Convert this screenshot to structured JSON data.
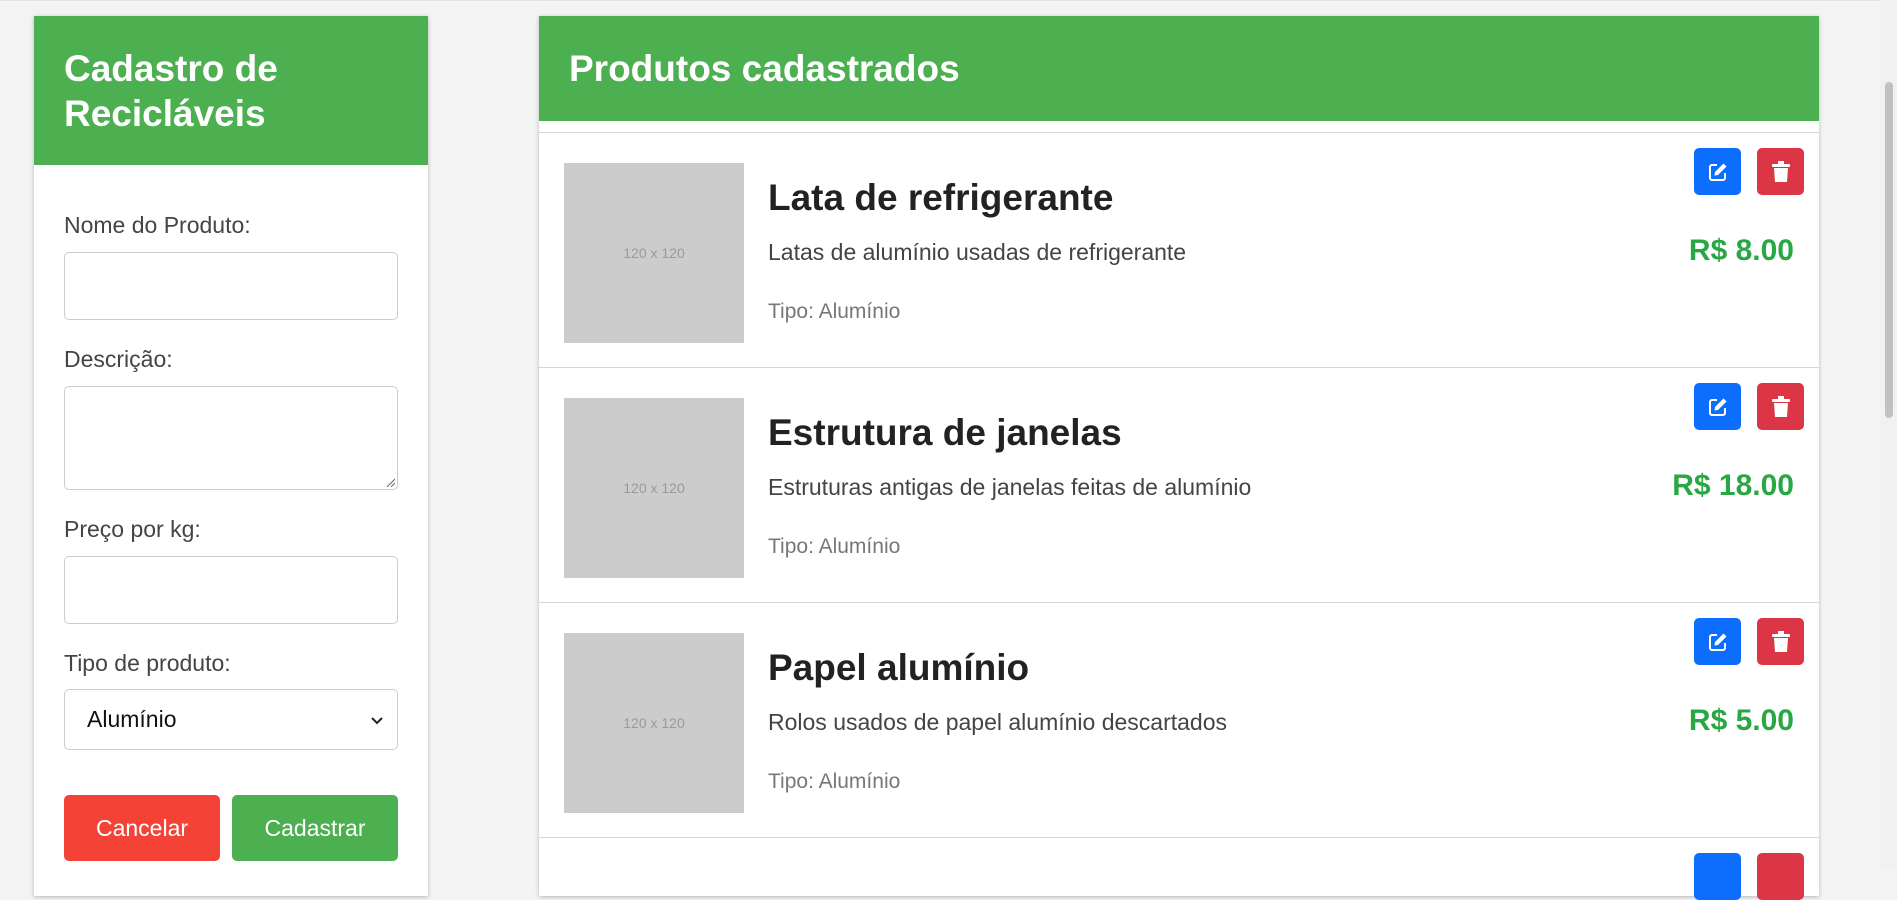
{
  "form": {
    "title": "Cadastro de Recicláveis",
    "fields": {
      "name_label": "Nome do Produto:",
      "name_value": "",
      "description_label": "Descrição:",
      "description_value": "",
      "price_label": "Preço por kg:",
      "price_value": "",
      "type_label": "Tipo de produto:",
      "type_selected": "Alumínio"
    },
    "cancel_label": "Cancelar",
    "submit_label": "Cadastrar"
  },
  "products": {
    "title": "Produtos cadastrados",
    "items": [
      {
        "image_text": "120 x 120",
        "name": "Lata de refrigerante",
        "description": "Latas de alumínio usadas de refrigerante",
        "type": "Tipo: Alumínio",
        "price": "R$ 8.00"
      },
      {
        "image_text": "120 x 120",
        "name": "Estrutura de janelas",
        "description": "Estruturas antigas de janelas feitas de alumínio",
        "type": "Tipo: Alumínio",
        "price": "R$ 18.00"
      },
      {
        "image_text": "120 x 120",
        "name": "Papel alumínio",
        "description": "Rolos usados de papel alumínio descartados",
        "type": "Tipo: Alumínio",
        "price": "R$ 5.00"
      }
    ]
  },
  "colors": {
    "header_green": "#4caf50",
    "price_green": "#28a745",
    "edit_blue": "#0d6efd",
    "delete_red": "#dc3545",
    "cancel_red": "#f44336"
  },
  "icons": {
    "edit": "pencil-square-icon",
    "delete": "trash-icon",
    "select": "chevron-down-icon"
  }
}
